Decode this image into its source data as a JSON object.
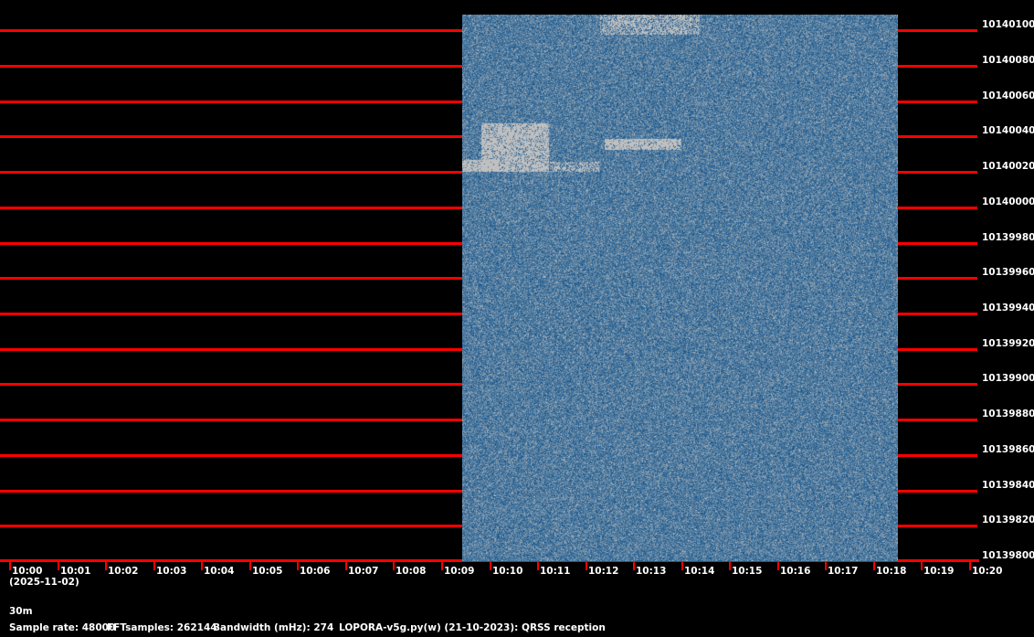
{
  "frequency_labels": [
    "10140100",
    "10140080",
    "10140060",
    "10140040",
    "10140020",
    "10140000",
    "10139980",
    "10139960",
    "10139940",
    "10139920",
    "10139900",
    "10139880",
    "10139860",
    "10139840",
    "10139820",
    "10139800"
  ],
  "time_labels": [
    "10:00",
    "10:01",
    "10:02",
    "10:03",
    "10:04",
    "10:05",
    "10:06",
    "10:07",
    "10:08",
    "10:09",
    "10:10",
    "10:11",
    "10:12",
    "10:13",
    "10:14",
    "10:15",
    "10:16",
    "10:17",
    "10:18",
    "10:19",
    "10:20"
  ],
  "date": "(2025-11-02)",
  "band": "30m",
  "status": {
    "sample_rate": "Sample rate: 48000",
    "fft_samples": "FFTsamples: 262144",
    "bandwidth": "Bandwidth (mHz): 274",
    "program": "LOPORA-v5g.py(w) (21-10-2023): QRSS reception"
  },
  "colors": {
    "grid": "#ff0000",
    "waterfall_low": "#0a4f8a",
    "waterfall_high": "#c0c0c0",
    "background": "#000000"
  }
}
